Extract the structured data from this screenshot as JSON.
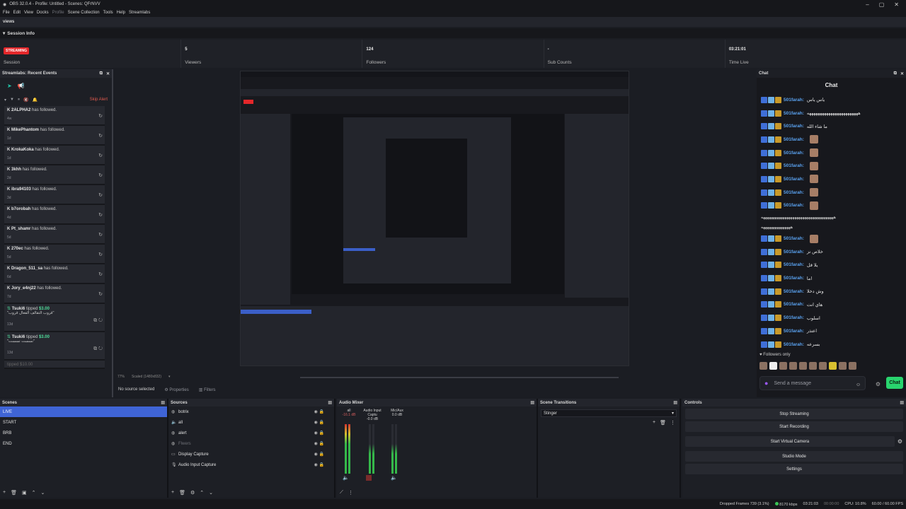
{
  "window": {
    "title": "OBS 32.0.4 - Profile: Untitled - Scenes: QFrNVV"
  },
  "menu": [
    "File",
    "Edit",
    "View",
    "Docks",
    "Profile",
    "Scene Collection",
    "Tools",
    "Help",
    "Streamlabs"
  ],
  "views_label": "views",
  "session": {
    "header": "Session Info",
    "stats": [
      {
        "value": "STREAMING",
        "label": "Session"
      },
      {
        "value": "5",
        "label": "Viewers"
      },
      {
        "value": "124",
        "label": "Followers"
      },
      {
        "value": "-",
        "label": "Sub Counts"
      },
      {
        "value": "03:21:01",
        "label": "Time Live"
      }
    ]
  },
  "recent_events": {
    "title": "Streamlabs: Recent Events",
    "skip_alert": "Skip Alert",
    "items": [
      {
        "user": "2ALPHA2",
        "action": "has followed.",
        "time": "4w"
      },
      {
        "user": "MikePhantom",
        "action": "has followed.",
        "time": "1d"
      },
      {
        "user": "KrokaKoka",
        "action": "has followed.",
        "time": "1d"
      },
      {
        "user": "3khh",
        "action": "has followed.",
        "time": "2d"
      },
      {
        "user": "ibra94103",
        "action": "has followed.",
        "time": "3d"
      },
      {
        "user": "b7orobah",
        "action": "has followed.",
        "time": "4d"
      },
      {
        "user": "Pt_shamr",
        "action": "has followed.",
        "time": "5d"
      },
      {
        "user": "270ec",
        "action": "has followed.",
        "time": "5d"
      },
      {
        "user": "Dragon_511_sa",
        "action": "has followed.",
        "time": "6d"
      },
      {
        "user": "Jory_e4nj22",
        "action": "has followed.",
        "time": "7d"
      }
    ],
    "tips": [
      {
        "user": "Tsuki6",
        "action": "tipped",
        "amount": "$3.00",
        "message": "\"قروب التقالف الفعال قروب\"",
        "time": "13d"
      },
      {
        "user": "Tsuki6",
        "action": "tipped",
        "amount": "$3.00",
        "message": "\"نسست نسست\"",
        "time": "13d"
      }
    ],
    "partial": "tipped $10.00"
  },
  "preview_footer": {
    "zoom": "77%",
    "scaled": "Scaled (1480x832)"
  },
  "context_bar": {
    "no_source": "No source selected",
    "properties": "Properties",
    "filters": "Filters"
  },
  "chat": {
    "dock_title": "Chat",
    "title": "Chat",
    "messages": [
      {
        "user": "501farah:",
        "text": "ياس ياس"
      },
      {
        "user": "501farah:",
        "text": "ههههههههههههههههههههههههه"
      },
      {
        "user": "501farah:",
        "text": "ما شاء الله"
      },
      {
        "user": "501farah:",
        "text": ""
      },
      {
        "user": "501farah:",
        "text": ""
      },
      {
        "user": "501farah:",
        "text": ""
      },
      {
        "user": "501farah:",
        "text": ""
      },
      {
        "user": "501farah:",
        "text": ""
      },
      {
        "user": "501farah:",
        "text": ""
      }
    ],
    "lines": [
      "هههههههههههههههههههههههههههههههههههههه",
      "هههههههههههههههه"
    ],
    "messages2": [
      {
        "user": "501farah:",
        "text": ""
      },
      {
        "user": "501farah:",
        "text": "خلاص نز"
      },
      {
        "user": "501farah:",
        "text": "يلا قل"
      },
      {
        "user": "501farah:",
        "text": "اما"
      },
      {
        "user": "501farah:",
        "text": "وش دخلا"
      },
      {
        "user": "501farah:",
        "text": "هاي انت"
      },
      {
        "user": "501farah:",
        "text": "اسلوب"
      },
      {
        "user": "501farah:",
        "text": "اعتذر"
      },
      {
        "user": "501farah:",
        "text": "بسرعه"
      }
    ],
    "followers_only": "Followers only",
    "input_placeholder": "Send a message",
    "send_label": "Chat"
  },
  "scenes": {
    "title": "Scenes",
    "items": [
      "LIVE",
      "START",
      "BRB",
      "END"
    ],
    "active_index": 0
  },
  "sources": {
    "title": "Sources",
    "items": [
      {
        "name": "botrix",
        "icon": "globe-icon",
        "dim": false
      },
      {
        "name": "all",
        "icon": "speaker-icon",
        "dim": false
      },
      {
        "name": "alert",
        "icon": "globe-icon",
        "dim": false
      },
      {
        "name": "Flwers",
        "icon": "globe-icon",
        "dim": true
      },
      {
        "name": "Display Capture",
        "icon": "monitor-icon",
        "dim": false
      },
      {
        "name": "Audio Input Capture",
        "icon": "mic-icon",
        "dim": false
      }
    ]
  },
  "mixer": {
    "title": "Audio Mixer",
    "channels": [
      {
        "name": "all",
        "db": "-16.1 dB"
      },
      {
        "name": "Audio Input Captu",
        "db": "-0.0 dB"
      },
      {
        "name": "Mic/Aux",
        "db": "0.0 dB"
      }
    ]
  },
  "transitions": {
    "title": "Scene Transitions",
    "selected": "Stinger"
  },
  "controls": {
    "title": "Controls",
    "buttons": [
      "Stop Streaming",
      "Start Recording",
      "Start Virtual Camera",
      "Studio Mode",
      "Settings"
    ]
  },
  "status": {
    "dropped": "Dropped Frames 739 (3.1%)",
    "kbps": "8170 kbps",
    "live_time": "03:21:03",
    "rec_time": "00:00:00",
    "cpu": "CPU: 10.8%",
    "fps": "60.00 / 60.00 FPS"
  }
}
